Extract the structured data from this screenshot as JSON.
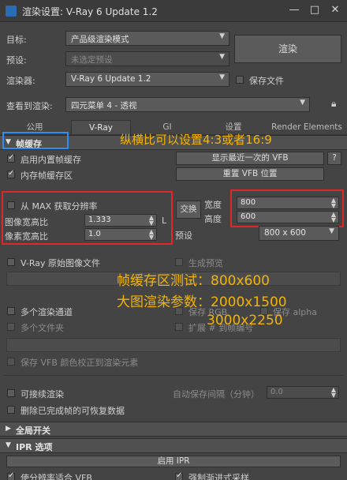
{
  "window": {
    "title": "渲染设置: V-Ray 6 Update 1.2"
  },
  "top": {
    "target_label": "目标:",
    "target_value": "产品级渲染模式",
    "preset_label": "预设:",
    "preset_value": "未选定预设",
    "renderer_label": "渲染器:",
    "renderer_value": "V-Ray 6 Update 1.2",
    "save_file_label": "保存文件",
    "view_label": "查看到渲染:",
    "view_value": "四元菜单 4 - 透视",
    "render_button": "渲染"
  },
  "tabs": [
    "公用",
    "V-Ray",
    "GI",
    "设置",
    "Render Elements"
  ],
  "frame_buffer": {
    "section_label": "帧缓存",
    "enable_vfb": "启用内置帧缓存",
    "memory_vfb": "内存帧缓存区",
    "show_last_vfb": "显示最近一次的 VFB",
    "help": "?",
    "reset_vfb": "重置 VFB 位置",
    "from_max": "从 MAX 获取分辨率",
    "image_aspect_label": "图像宽高比",
    "image_aspect_value": "1.333",
    "lock": "L",
    "pixel_aspect_label": "像素宽高比",
    "pixel_aspect_value": "1.0",
    "swap": "交换",
    "width_label": "宽度",
    "width_value": "800",
    "height_label": "高度",
    "height_value": "600",
    "preset_label": "预设",
    "preset_value": "800 x 600",
    "raw_image": "V-Ray 原始图像文件",
    "gen_preview": "生成预览",
    "multi_channel": "多个渲染通道",
    "save_rgb": "保存 RGB",
    "save_alpha": "保存 alpha",
    "multi_files": "多个文件夹",
    "extension": "扩展 # 到帧编号",
    "save_vfb_color": "保存 VFB 颜色校正到渲染元素",
    "resumable": "可接续渲染",
    "autosave_label": "自动保存间隔（分钟）",
    "autosave_value": "0.0",
    "delete_resumable": "删除已完成帧的可恢复数据"
  },
  "global_switches": {
    "section_label": "全局开关"
  },
  "ipr": {
    "section_label": "IPR 选项",
    "start_ipr": "启用 IPR",
    "fit_resolution": "使分辨率适合 VFB",
    "force_progressive": "强制渐进式采样"
  },
  "annotations": {
    "ratio_note": "纵横比可以设置4:3或者16:9",
    "vfb_test": "帧缓存区测试：800x600",
    "final_params": "大图渲染参数：2000x1500",
    "final_alt": "3000x2250"
  },
  "colors": {
    "highlight_red": "#e0282a",
    "highlight_blue": "#2d8ef0",
    "annotation": "#f5b400",
    "accent": "#2a6db5"
  }
}
